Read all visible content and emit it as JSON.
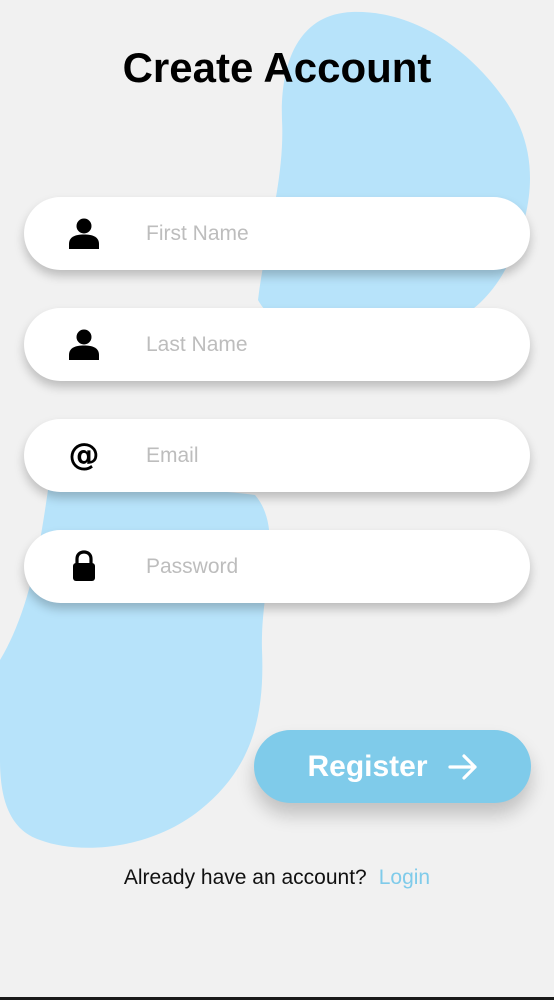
{
  "page": {
    "title": "Create Account"
  },
  "form": {
    "fields": [
      {
        "icon": "person-icon",
        "placeholder": "First Name",
        "value": ""
      },
      {
        "icon": "person-icon",
        "placeholder": "Last Name",
        "value": ""
      },
      {
        "icon": "at-sign-icon",
        "icon_glyph": "@",
        "placeholder": "Email",
        "value": ""
      },
      {
        "icon": "lock-icon",
        "placeholder": "Password",
        "value": ""
      }
    ],
    "register_label": "Register",
    "register_icon": "arrow-right-icon"
  },
  "footer": {
    "prompt": "Already have an account?",
    "login_label": "Login"
  },
  "colors": {
    "background": "#f1f1f1",
    "blob": "#b7e3fa",
    "accent": "#7fcbea",
    "placeholder": "#bdbdbd",
    "field_background": "#ffffff"
  }
}
